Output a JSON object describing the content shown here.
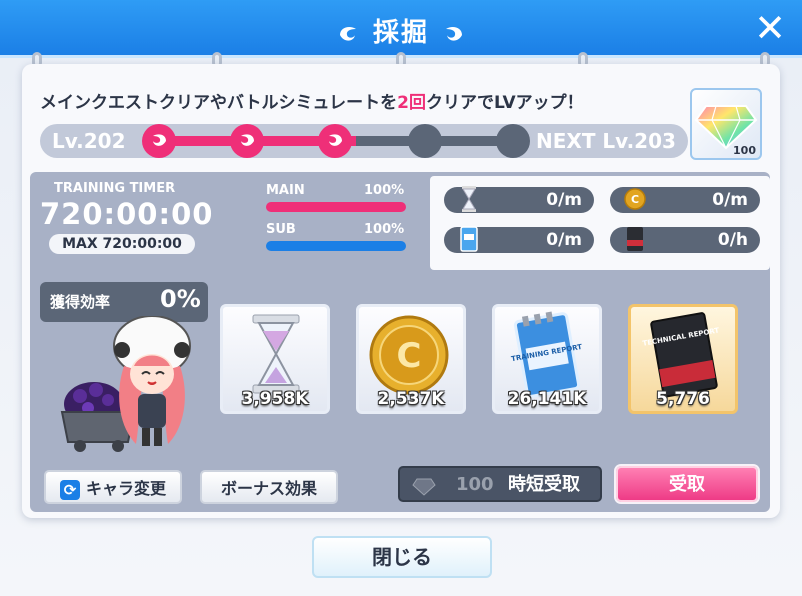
{
  "header": {
    "title": "採掘",
    "close_label": "✕"
  },
  "mission": {
    "text_before": "メインクエストクリアやバトルシミュレートを",
    "highlight": "2回",
    "text_after": "クリアでLVアップ！"
  },
  "level": {
    "current": "Lv.202",
    "next": "NEXT Lv.203",
    "steps_total": 5,
    "steps_done": 3,
    "reward_count": "100"
  },
  "timer": {
    "label": "TRAINING TIMER",
    "value": "720:00:00",
    "max": "MAX 720:00:00"
  },
  "gauges": [
    {
      "label": "MAIN",
      "percent_label": "100%",
      "fill": 1.0,
      "color": "#ef2f78"
    },
    {
      "label": "SUB",
      "percent_label": "100%",
      "fill": 1.0,
      "color": "#1b7fe6"
    }
  ],
  "rates": [
    {
      "icon": "hourglass-icon",
      "value": "0/m"
    },
    {
      "icon": "coin-icon",
      "value": "0/m"
    },
    {
      "icon": "training-report-icon",
      "value": "0/m"
    },
    {
      "icon": "technical-report-icon",
      "value": "0/h"
    }
  ],
  "efficiency": {
    "label": "獲得効率",
    "value": "0%"
  },
  "resources": [
    {
      "icon": "hourglass-icon",
      "qty": "3,958K"
    },
    {
      "icon": "coin-icon",
      "qty": "2,537K"
    },
    {
      "icon": "training-report-icon",
      "qty": "26,141K",
      "card_text": "TRAINING REPORT"
    },
    {
      "icon": "technical-report-icon",
      "qty": "5,776",
      "card_text": "TECHNICAL REPORT"
    }
  ],
  "buttons": {
    "change_character": "キャラ変更",
    "bonus_effect": "ボーナス効果",
    "time_skip_cost": "100",
    "time_skip": "時短受取",
    "receive": "受取",
    "close": "閉じる"
  },
  "colors": {
    "accent_pink": "#ef2f78",
    "accent_blue": "#1b7fe6",
    "slate": "#5b6677"
  }
}
